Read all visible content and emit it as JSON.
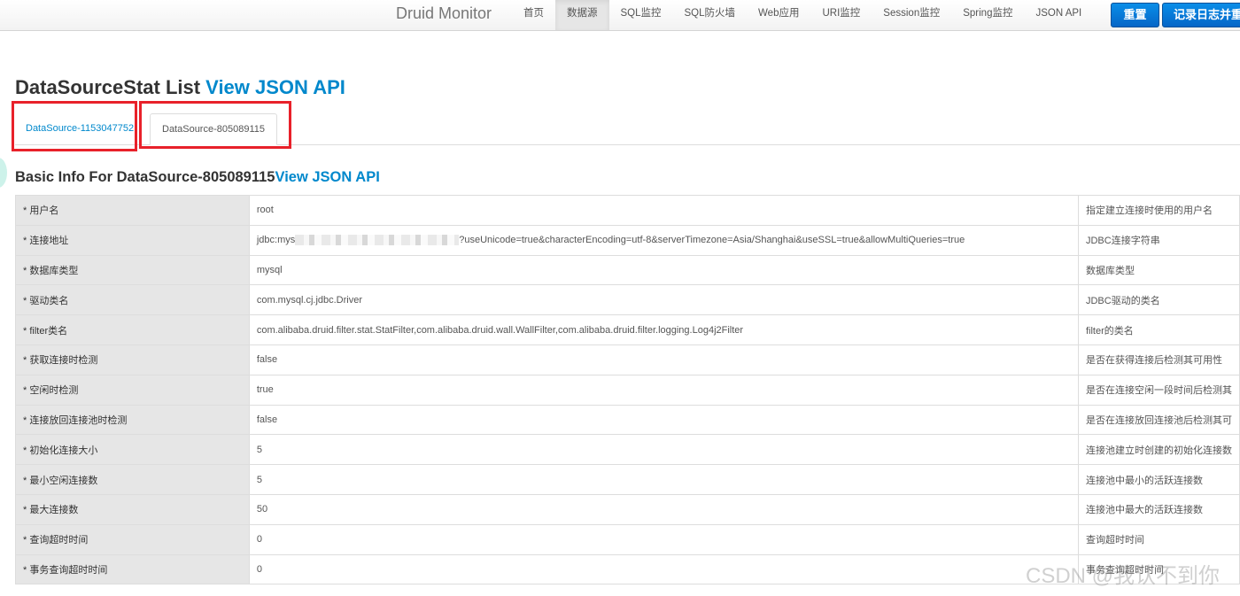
{
  "navbar": {
    "brand": "Druid Monitor",
    "items": [
      "首页",
      "数据源",
      "SQL监控",
      "SQL防火墙",
      "Web应用",
      "URI监控",
      "Session监控",
      "Spring监控",
      "JSON API"
    ],
    "active_index": 1,
    "reset_label": "重置",
    "log_label": "记录日志并重置"
  },
  "page": {
    "title": "DataSourceStat List ",
    "title_link": "View JSON API",
    "tabs": [
      "DataSource-1153047752",
      "DataSource-805089115"
    ],
    "section_title": "Basic Info For DataSource-805089115",
    "section_link": "View JSON API"
  },
  "table": {
    "rows": [
      {
        "key": "* 用户名",
        "value": "root",
        "desc": "指定建立连接时使用的用户名"
      },
      {
        "key": "* 连接地址",
        "value_prefix": "jdbc:mys",
        "value": "?useUnicode=true&characterEncoding=utf-8&serverTimezone=Asia/Shanghai&useSSL=true&allowMultiQueries=true",
        "desc": "JDBC连接字符串"
      },
      {
        "key": "* 数据库类型",
        "value": "mysql",
        "desc": "数据库类型"
      },
      {
        "key": "* 驱动类名",
        "value": "com.mysql.cj.jdbc.Driver",
        "desc": "JDBC驱动的类名"
      },
      {
        "key": "* filter类名",
        "value": "com.alibaba.druid.filter.stat.StatFilter,com.alibaba.druid.wall.WallFilter,com.alibaba.druid.filter.logging.Log4j2Filter",
        "desc": "filter的类名"
      },
      {
        "key": "* 获取连接时检测",
        "value": "false",
        "desc": "是否在获得连接后检测其可用性"
      },
      {
        "key": "* 空闲时检测",
        "value": "true",
        "desc": "是否在连接空闲一段时间后检测其"
      },
      {
        "key": "* 连接放回连接池时检测",
        "value": "false",
        "desc": "是否在连接放回连接池后检测其可"
      },
      {
        "key": "* 初始化连接大小",
        "value": "5",
        "desc": "连接池建立时创建的初始化连接数"
      },
      {
        "key": "* 最小空闲连接数",
        "value": "5",
        "desc": "连接池中最小的活跃连接数"
      },
      {
        "key": "* 最大连接数",
        "value": "50",
        "desc": "连接池中最大的活跃连接数"
      },
      {
        "key": "* 查询超时时间",
        "value": "0",
        "desc": "查询超时时间"
      },
      {
        "key": "* 事务查询超时时间",
        "value": "0",
        "desc": "事务查询超时时间"
      }
    ]
  },
  "watermark": "CSDN @我认不到你",
  "colors": {
    "link": "#0088cc",
    "button": "#0566c7",
    "highlight": "#e8212a"
  }
}
